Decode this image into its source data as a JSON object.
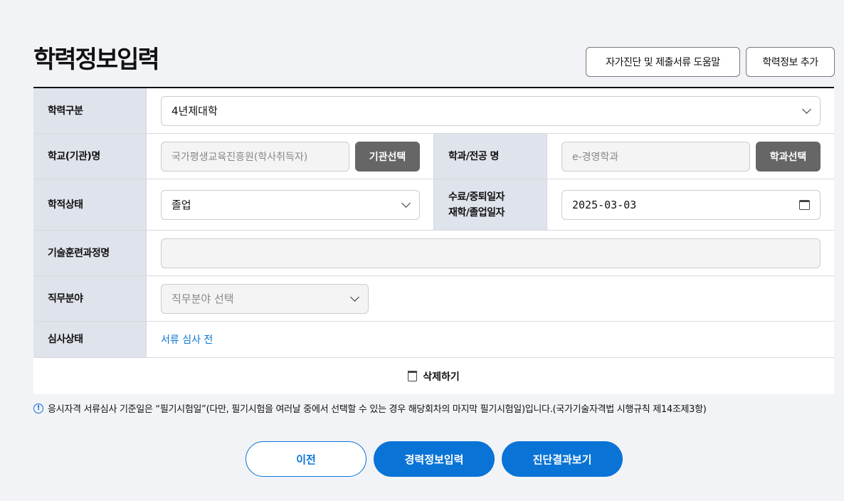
{
  "title": "학력정보입력",
  "buttons": {
    "help": "자가진단 및 제출서류 도움말",
    "add": "학력정보 추가",
    "delete": "삭제하기",
    "prev": "이전",
    "career": "경력정보입력",
    "result": "진단결과보기"
  },
  "form": {
    "edu_type": {
      "label": "학력구분",
      "value": "4년제대학"
    },
    "school": {
      "label": "학교(기관)명",
      "value": "국가평생교육진흥원(학사취득자)",
      "button": "기관선택"
    },
    "major": {
      "label": "학과/전공 명",
      "value": "e-경영학과",
      "button": "학과선택"
    },
    "status": {
      "label": "학적상태",
      "value": "졸업"
    },
    "date": {
      "label1": "수료/중퇴일자",
      "label2": "재학/졸업일자",
      "value": "2025-03-03"
    },
    "course": {
      "label": "기술훈련과정명",
      "value": ""
    },
    "job": {
      "label": "직무분야",
      "placeholder": "직무분야 선택"
    },
    "review": {
      "label": "심사상태",
      "value": "서류 심사 전"
    }
  },
  "notice": "응시자격 서류심사 기준일은 “필기시험일”(다만, 필기시험을 여러날 중에서 선택할 수 있는 경우 해당회차의 마지막 필기시험일)입니다.(국가기술자격법 시행규칙 제14조제3항)",
  "colors": {
    "accent": "#0a74d6",
    "label_bg": "#dfe3eb"
  }
}
